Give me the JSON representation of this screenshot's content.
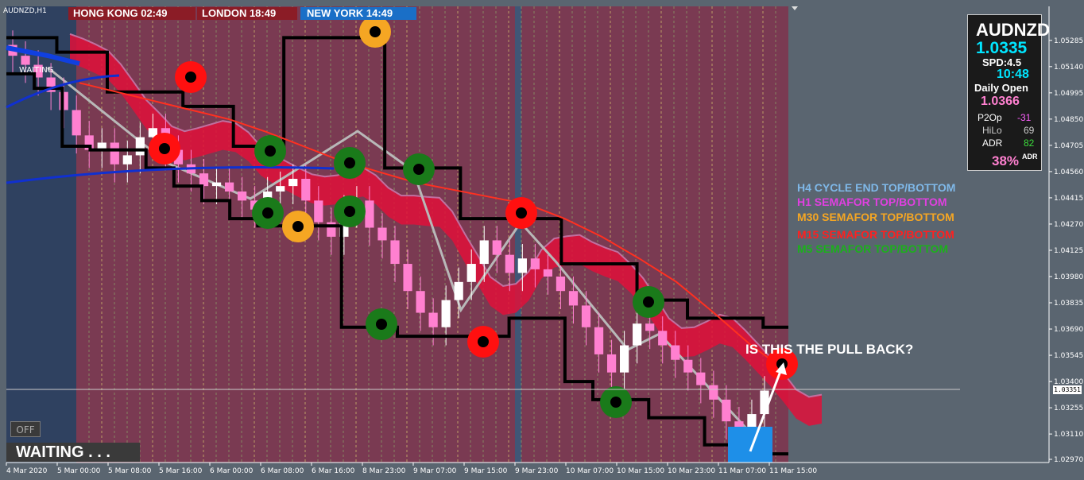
{
  "symbol": "AUDNZD,H1",
  "sessions": {
    "hong_kong": "HONG KONG  02:49",
    "london": "LONDON   18:49",
    "new_york": "NEW YORK  14:49"
  },
  "info_panel": {
    "pair": "AUDNZD",
    "price": "1.0335",
    "spread": "SPD:4.5",
    "time": "10:48",
    "daily_open_label": "Daily Open",
    "daily_open": "1.0366",
    "p2op_label": "P2Op",
    "p2op": "-31",
    "hilo_label": "HiLo",
    "hilo": "69",
    "adr_label": "ADR",
    "adr": "82",
    "adr_pct": "38%",
    "adr_pct_label": "ADR"
  },
  "legend": [
    {
      "text": "H4 CYCLE END TOP/BOTTOM",
      "color": "#7fb8e8"
    },
    {
      "text": "H1 SEMAFOR TOP/BOTTOM",
      "color": "#e040e0"
    },
    {
      "text": "M30 SEMAFOR TOP/BOTTOM",
      "color": "#f5a623"
    },
    {
      "text": "M15 SEMAFOR TOP/BOTTOM",
      "color": "#ff2020"
    },
    {
      "text": "M5 SEMAFOR TOP/BOTTOM",
      "color": "#1cb01c"
    }
  ],
  "callout": "IS THIS THE PULL BACK?",
  "waiting_small": "WAITING",
  "off_button": "OFF",
  "waiting_banner": "WAITING . . .",
  "current_price_tag": "1.03351",
  "colors": {
    "background": "#5a6570",
    "session_shade": "#7a3a52",
    "bull_candle": "#ffffff",
    "bear_candle": "#ff80d0",
    "ma_fast": "#e0103a",
    "ma_slow": "#ff3020",
    "channel": "#000000",
    "ma_long": "#1030d0"
  },
  "chart_data": {
    "type": "candlestick",
    "symbol": "AUDNZD",
    "timeframe": "H1",
    "ylim": [
      1.0297,
      1.0535
    ],
    "y_ticks": [
      "1.05285",
      "1.05140",
      "1.04995",
      "1.04850",
      "1.04705",
      "1.04560",
      "1.04415",
      "1.04270",
      "1.04125",
      "1.03980",
      "1.03835",
      "1.03690",
      "1.03545",
      "1.03400",
      "1.03255",
      "1.03110",
      "1.02970"
    ],
    "x_ticks": [
      "4 Mar 2020",
      "5 Mar 00:00",
      "5 Mar 08:00",
      "5 Mar 16:00",
      "6 Mar 00:00",
      "6 Mar 08:00",
      "6 Mar 16:00",
      "8 Mar 23:00",
      "9 Mar 07:00",
      "9 Mar 15:00",
      "9 Mar 23:00",
      "10 Mar 07:00",
      "10 Mar 15:00",
      "10 Mar 23:00",
      "11 Mar 07:00",
      "11 Mar 15:00"
    ],
    "current_price": 1.03351,
    "series": [
      {
        "name": "close",
        "values": [
          1.052,
          1.0515,
          1.0508,
          1.05,
          1.049,
          1.0476,
          1.0468,
          1.0472,
          1.046,
          1.0465,
          1.0475,
          1.048,
          1.0468,
          1.046,
          1.0455,
          1.0448,
          1.045,
          1.0445,
          1.044,
          1.0435,
          1.0445,
          1.0448,
          1.0452,
          1.044,
          1.0428,
          1.042,
          1.0435,
          1.044,
          1.0425,
          1.0418,
          1.0405,
          1.039,
          1.0378,
          1.037,
          1.0385,
          1.0395,
          1.0405,
          1.0418,
          1.041,
          1.04,
          1.0408,
          1.0402,
          1.0398,
          1.039,
          1.0382,
          1.037,
          1.0355,
          1.0345,
          1.036,
          1.0372,
          1.0368,
          1.036,
          1.0352,
          1.0345,
          1.0338,
          1.033,
          1.0318,
          1.0308,
          1.0322,
          1.0335
        ]
      },
      {
        "name": "channel_upper",
        "values": [
          1.053,
          1.053,
          1.0522,
          1.0522,
          1.05,
          1.05,
          1.05,
          1.0492,
          1.0492,
          1.047,
          1.047,
          1.053,
          1.053,
          1.053,
          1.053,
          1.0458,
          1.0458,
          1.0458,
          1.043,
          1.043,
          1.043,
          1.043,
          1.0405,
          1.0405,
          1.0405,
          1.0385,
          1.0385,
          1.0375,
          1.0375,
          1.0375,
          1.037,
          1.037
        ]
      },
      {
        "name": "channel_lower",
        "values": [
          1.051,
          1.0502,
          1.047,
          1.0468,
          1.0468,
          1.0458,
          1.0448,
          1.044,
          1.043,
          1.0426,
          1.0426,
          1.0426,
          1.037,
          1.037,
          1.0365,
          1.0365,
          1.0365,
          1.0365,
          1.0375,
          1.0375,
          1.034,
          1.033,
          1.033,
          1.032,
          1.032,
          1.0305,
          1.03,
          1.03,
          1.03
        ]
      },
      {
        "name": "ma_slow",
        "values": [
          1.0505,
          1.05,
          1.0495,
          1.049,
          1.0485,
          1.0478,
          1.047,
          1.0462,
          1.0456,
          1.045,
          1.0446,
          1.0442,
          1.0438,
          1.043,
          1.042,
          1.0408,
          1.0395,
          1.0378,
          1.036,
          1.0345
        ]
      }
    ]
  }
}
